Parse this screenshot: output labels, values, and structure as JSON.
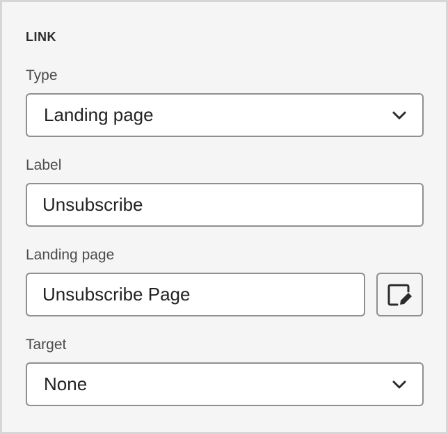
{
  "section": {
    "title": "LINK"
  },
  "type_field": {
    "label": "Type",
    "value": "Landing page"
  },
  "label_field": {
    "label": "Label",
    "value": "Unsubscribe"
  },
  "landing_page_field": {
    "label": "Landing page",
    "value": "Unsubscribe Page",
    "edit_icon": "edit-icon"
  },
  "target_field": {
    "label": "Target",
    "value": "None"
  },
  "icons": {
    "dropdown": "chevron-down-icon",
    "edit": "edit-icon"
  },
  "colors": {
    "panel_background": "#f5f5f5",
    "field_background": "#ffffff",
    "border": "#8f8f8f",
    "text": "#222222",
    "label": "#4b4b4b"
  }
}
